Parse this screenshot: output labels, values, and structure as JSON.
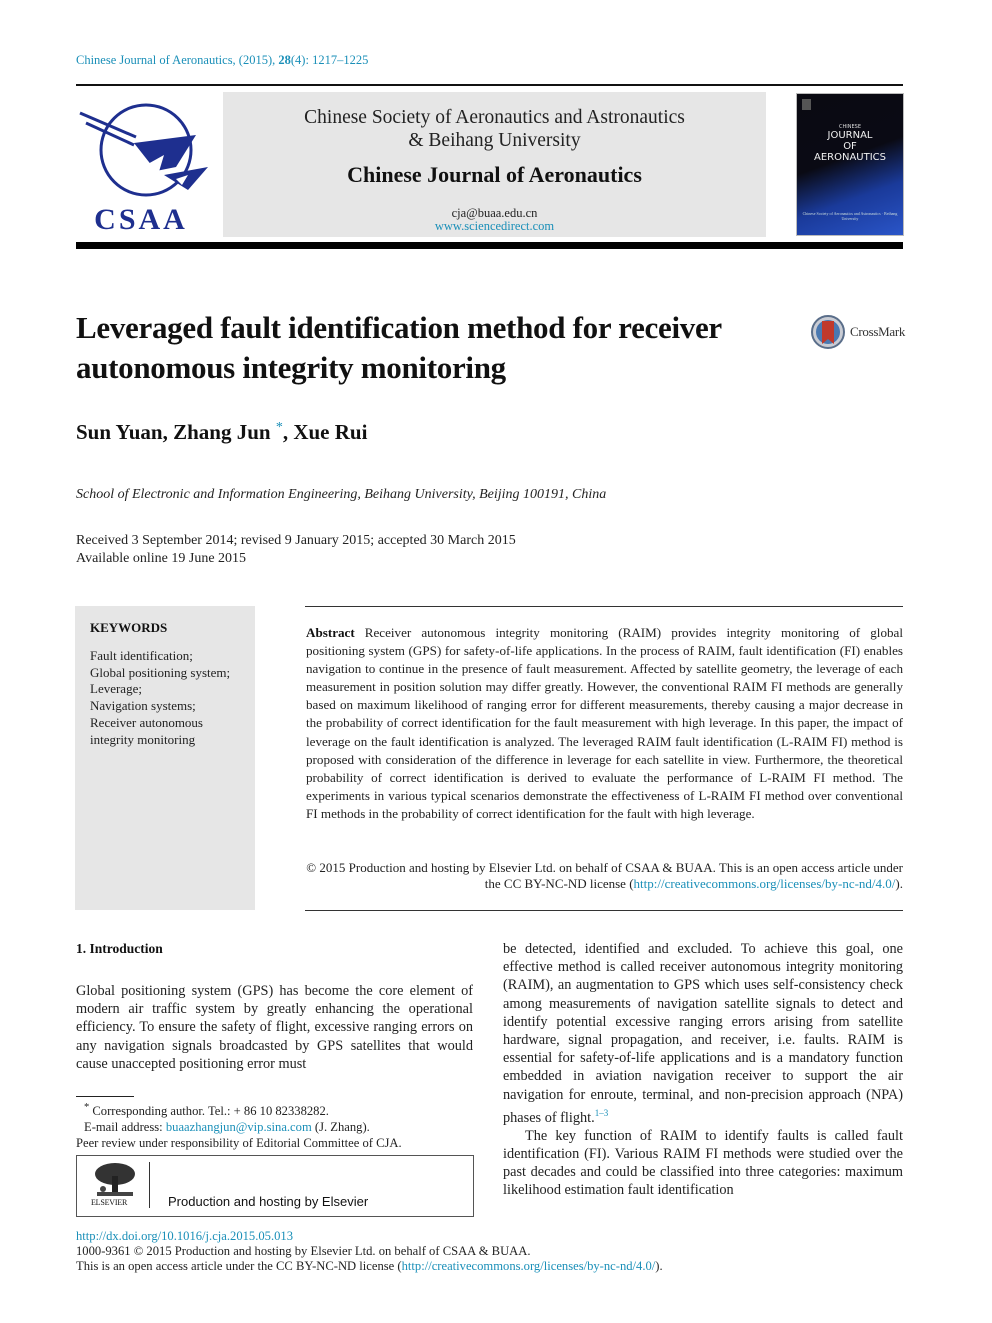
{
  "citation": {
    "journal": "Chinese Journal of Aeronautics, (2015), ",
    "volume": "28",
    "issue_pages": "(4): 1217–1225"
  },
  "header": {
    "logo_text": "CSAA",
    "society_line1": "Chinese Society of Aeronautics and Astronautics",
    "society_line2": "& Beihang University",
    "journal_name": "Chinese Journal of Aeronautics",
    "email": "cja@buaa.edu.cn",
    "website": "www.sciencedirect.com",
    "cover": {
      "small": "CHINESE",
      "title_lines": [
        "JOURNAL",
        "OF",
        "AERONAUTICS"
      ],
      "foot": "Chinese Society of Aeronautics and Astronautics · Beihang University"
    }
  },
  "article": {
    "title": "Leveraged fault identification method for receiver autonomous integrity monitoring",
    "crossmark_label": "CrossMark",
    "authors": {
      "part1": "Sun Yuan, Zhang Jun",
      "star": "*",
      "part2": ", Xue Rui"
    },
    "affiliation": "School of Electronic and Information Engineering, Beihang University, Beijing 100191, China",
    "received": "Received 3 September 2014; revised 9 January 2015; accepted 30 March 2015",
    "available": "Available online 19 June 2015"
  },
  "keywords": {
    "heading": "KEYWORDS",
    "items": [
      "Fault identification;",
      "Global positioning system;",
      "Leverage;",
      "Navigation systems;",
      "Receiver autonomous integrity monitoring"
    ]
  },
  "abstract": {
    "label": "Abstract",
    "text": "Receiver autonomous integrity monitoring (RAIM) provides integrity monitoring of global positioning system (GPS) for safety-of-life applications. In the process of RAIM, fault identification (FI) enables navigation to continue in the presence of fault measurement. Affected by satellite geometry, the leverage of each measurement in position solution may differ greatly. However, the conventional RAIM FI methods are generally based on maximum likelihood of ranging error for different measurements, thereby causing a major decrease in the probability of correct identification for the fault measurement with high leverage. In this paper, the impact of leverage on the fault identification is analyzed. The leveraged RAIM fault identification (L-RAIM FI) method is proposed with consideration of the difference in leverage for each satellite in view. Furthermore, the theoretical probability of correct identification is derived to evaluate the performance of L-RAIM FI method. The experiments in various typical scenarios demonstrate the effectiveness of L-RAIM FI method over conventional FI methods in the probability of correct identification for the fault with high leverage.",
    "copyright_pre": "© 2015 Production and hosting by Elsevier Ltd. on behalf of CSAA & BUAA. This is an open access article under the CC BY-NC-ND license (",
    "license_url": "http://creativecommons.org/licenses/by-nc-nd/4.0/",
    "copyright_post": ")."
  },
  "introduction": {
    "heading": "1. Introduction",
    "left_text": "Global positioning system (GPS) has become the core element of modern air traffic system by greatly enhancing the operational efficiency. To ensure the safety of flight, excessive ranging errors on any navigation signals broadcasted by GPS satellites that would cause unaccepted positioning error must",
    "right_para1": "be detected, identified and excluded. To achieve this goal, one effective method is called receiver autonomous integrity monitoring (RAIM), an augmentation to GPS which uses self-consistency check among measurements of navigation satellite signals to detect and identify potential excessive ranging errors arising from satellite hardware, signal propagation, and receiver, i.e. faults. RAIM is essential for safety-of-life applications and is a mandatory function embedded in aviation navigation receiver to support the air navigation for enroute, terminal, and non-precision approach (NPA) phases of flight.",
    "right_para1_ref": "1–3",
    "right_para2": "The key function of RAIM to identify faults is called fault identification (FI). Various RAIM FI methods were studied over the past decades and could be classified into three categories: maximum likelihood estimation fault identification"
  },
  "footnotes": {
    "star": "*",
    "corresponding": "Corresponding author. Tel.: + 86 10 82338282.",
    "email_label": "E-mail address: ",
    "email": "buaazhangjun@vip.sina.com",
    "email_suffix": " (J. Zhang).",
    "peer_review": "Peer review under responsibility of Editorial Committee of CJA.",
    "elsevier_logo_label": "ELSEVIER",
    "production": "Production and hosting by Elsevier"
  },
  "footer": {
    "doi": "http://dx.doi.org/10.1016/j.cja.2015.05.013",
    "issn_line": "1000-9361 © 2015 Production and hosting by Elsevier Ltd. on behalf of CSAA & BUAA.",
    "license_pre": "This is an open access article under the CC BY-NC-ND license (",
    "license_url": "http://creativecommons.org/licenses/by-nc-nd/4.0/",
    "license_post": ")."
  },
  "colors": {
    "link": "#1a8fb8",
    "csaa_blue": "#1e2f8f",
    "banner_bg": "#e6e6e6",
    "crossmark_red": "#c0392b"
  }
}
